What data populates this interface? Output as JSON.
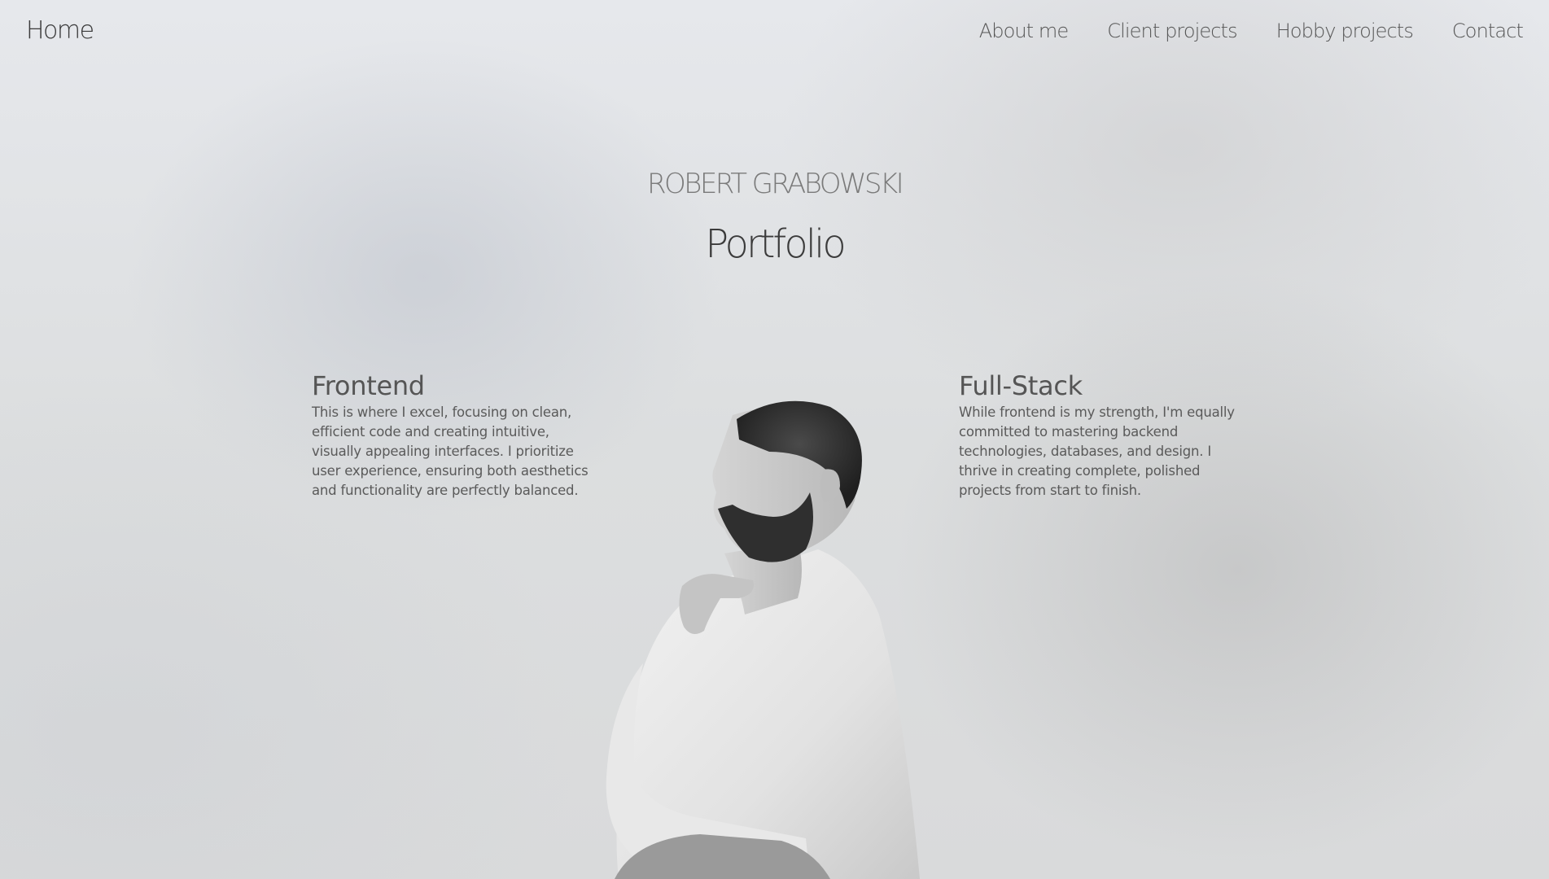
{
  "nav": {
    "home_label": "Home",
    "links": [
      {
        "label": "About me"
      },
      {
        "label": "Client projects"
      },
      {
        "label": "Hobby projects"
      },
      {
        "label": "Contact"
      }
    ]
  },
  "hero": {
    "name": "ROBERT GRABOWSKI",
    "title": "Portfolio"
  },
  "skills": [
    {
      "heading": "Frontend",
      "text": "This is where I excel, focusing on clean, efficient code and creating intuitive, visually appealing interfaces. I prioritize user experience, ensuring both aesthetics and functionality are perfectly balanced."
    },
    {
      "heading": "Full-Stack",
      "text": "While frontend is my strength, I'm equally committed to mastering backend technologies, databases, and design. I thrive in creating complete, polished projects from start to finish."
    }
  ]
}
